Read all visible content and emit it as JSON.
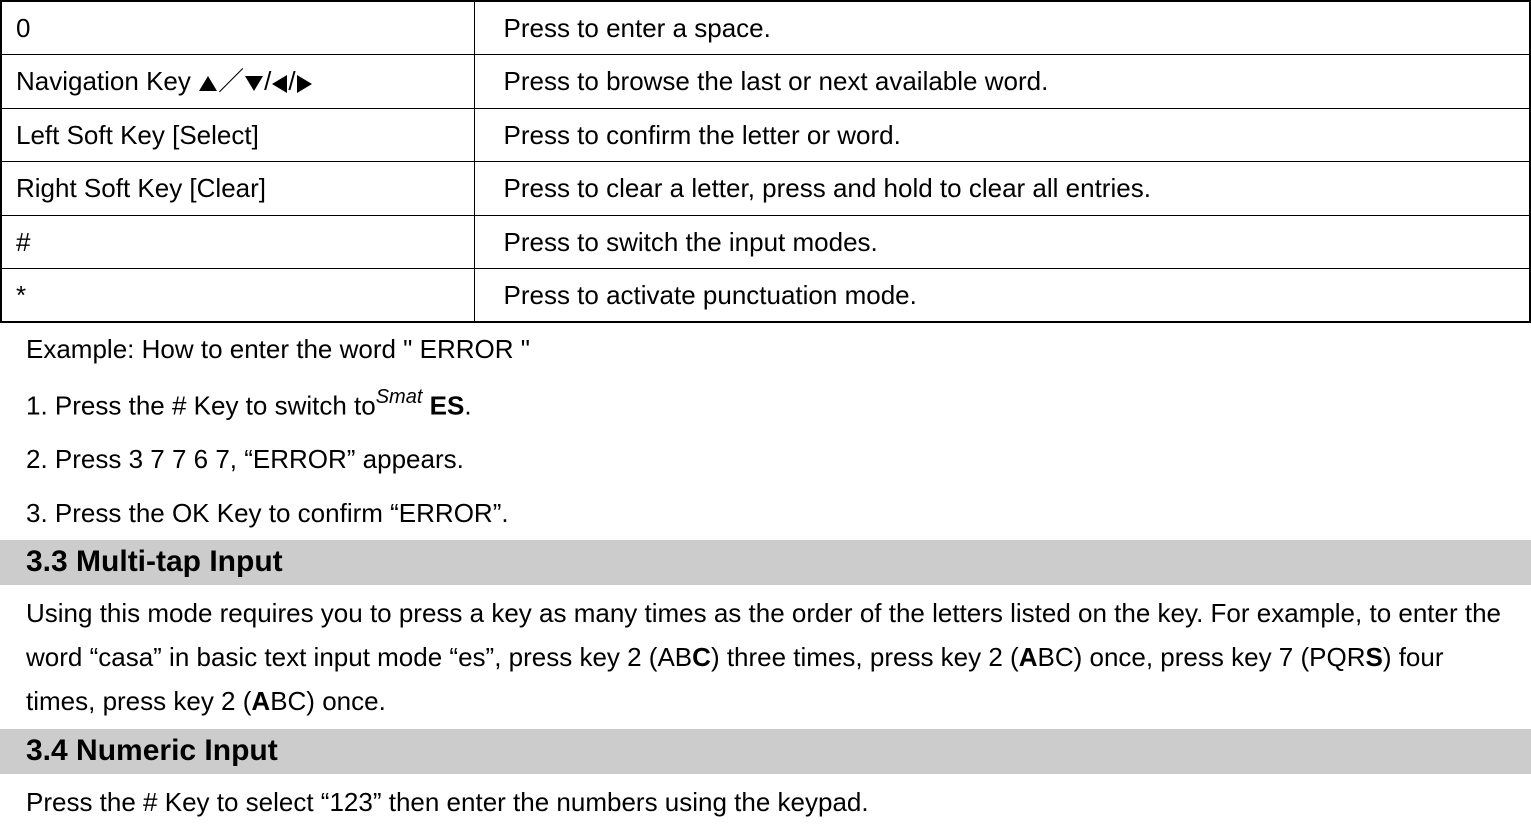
{
  "table": {
    "rows": [
      {
        "key": "0",
        "desc": "Press to enter a space."
      },
      {
        "key_prefix": "Navigation Key  ",
        "desc": "Press to browse the last or next available word."
      },
      {
        "key": "Left Soft Key [Select]",
        "desc": "Press to confirm the letter or word."
      },
      {
        "key": "Right Soft Key [Clear]",
        "desc": "Press to clear a letter, press and hold to clear all entries."
      },
      {
        "key": "#",
        "desc": "Press to switch the input modes."
      },
      {
        "key": "*",
        "desc": "Press to activate punctuation mode."
      }
    ]
  },
  "example": {
    "intro": "Example: How to enter the word \" ERROR \"",
    "step1_a": "1. Press the # Key to switch to",
    "step1_smat": "Smat",
    "step1_b": " ES",
    "step1_c": ".",
    "step2": "2. Press 3 7 7 6 7, “ERROR” appears.",
    "step3": "3. Press the OK Key to confirm “ERROR”."
  },
  "section33": {
    "heading": "3.3  Multi-tap Input",
    "p1_a": "Using this mode requires you to press a key as many times as the order of the letters listed on the key. For example, to enter the word “casa” in basic text input mode “es”, press key 2 (AB",
    "p1_b": "C",
    "p1_c": ") three times, press key 2 (",
    "p1_d": "A",
    "p1_e": "BC) once, press key 7 (PQR",
    "p1_f": "S",
    "p1_g": ") four times, press key 2 (",
    "p1_h": "A",
    "p1_i": "BC) once."
  },
  "section34": {
    "heading": "3.4  Numeric Input",
    "p1": "Press the # Key to select “123” then enter the numbers using the keypad."
  }
}
